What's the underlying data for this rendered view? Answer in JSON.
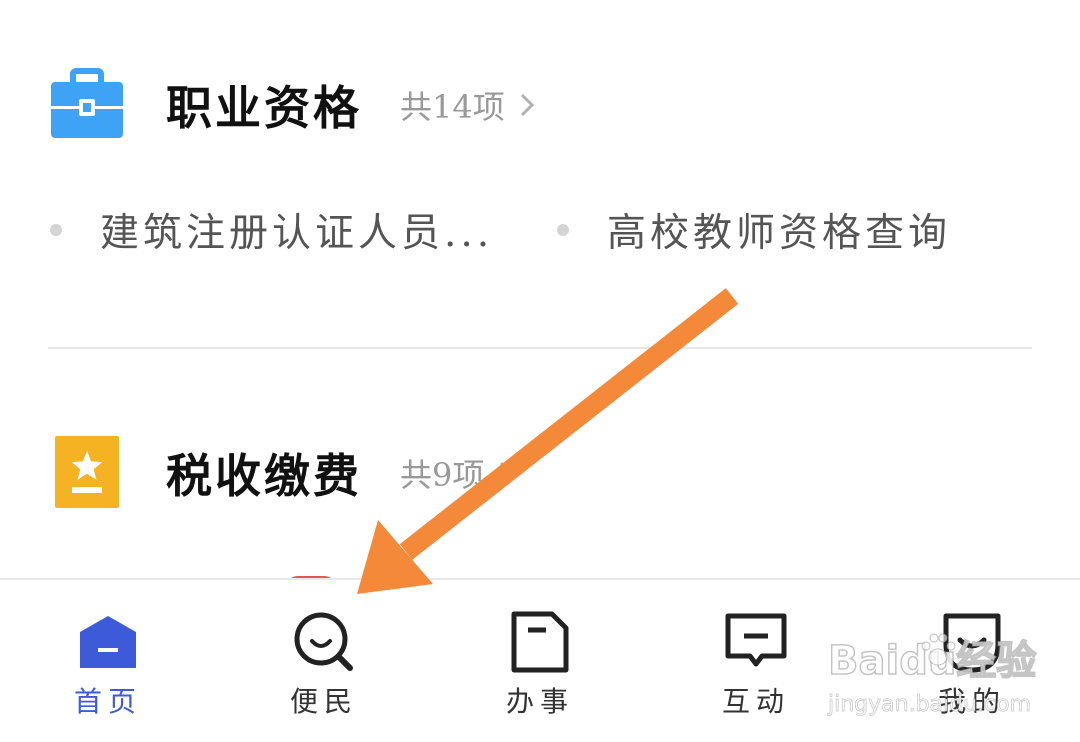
{
  "sections": [
    {
      "icon": "briefcase-icon",
      "icon_color": "#3fa3f5",
      "title": "职业资格",
      "count": "共14项",
      "items": [
        "建筑注册认证人员...",
        "高校教师资格查询"
      ]
    },
    {
      "icon": "star-certificate-icon",
      "icon_color": "#f5b324",
      "title": "税收缴费",
      "count": "共9项"
    }
  ],
  "tabbar": {
    "accent_color": "#3d5bd9",
    "tabs": [
      {
        "label": "首页",
        "icon": "home-icon",
        "active": true
      },
      {
        "label": "便民",
        "icon": "search-smile-icon",
        "active": false
      },
      {
        "label": "办事",
        "icon": "document-icon",
        "active": false
      },
      {
        "label": "互动",
        "icon": "message-icon",
        "active": false
      },
      {
        "label": "我的",
        "icon": "smile-face-icon",
        "active": false
      }
    ]
  },
  "annotation": {
    "type": "arrow",
    "color": "#f5893a"
  },
  "watermark": {
    "brand": "Baidu经验",
    "url": "jingyan.baidu.com"
  }
}
